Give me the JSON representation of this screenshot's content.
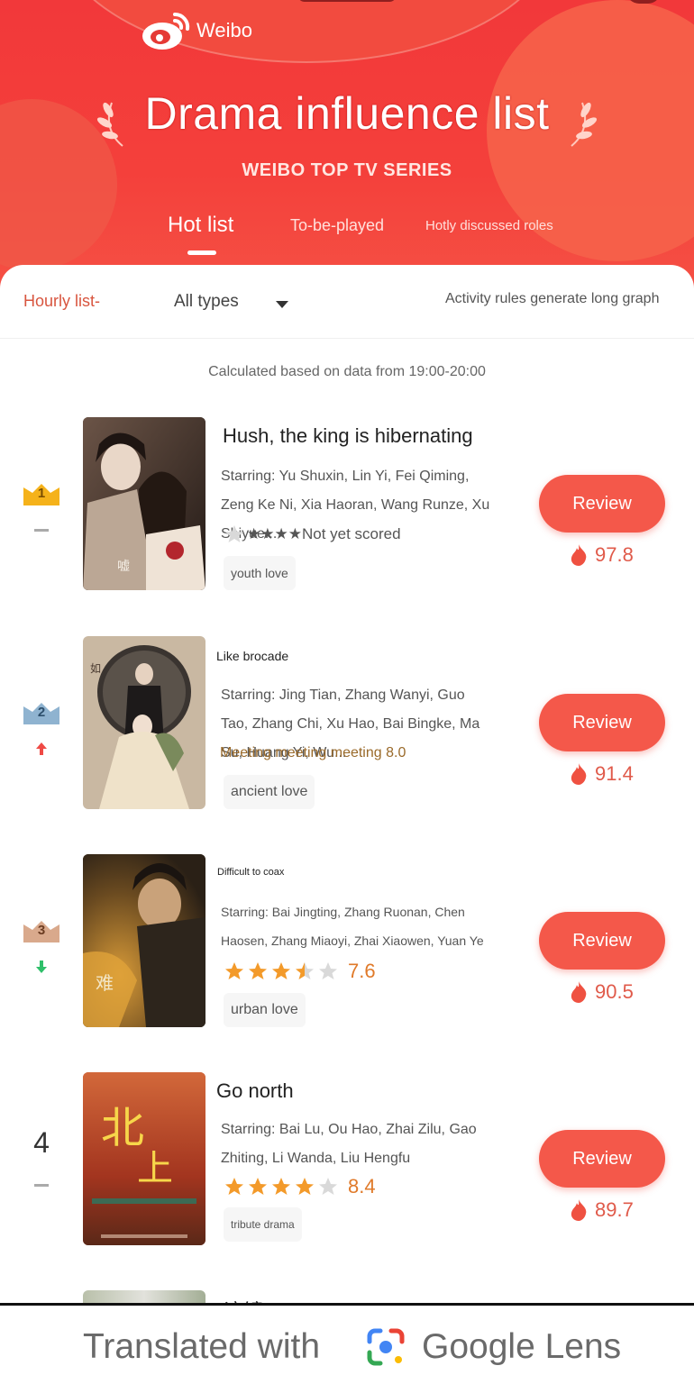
{
  "header": {
    "logo_text": "Weibo",
    "title": "Drama influence list",
    "subtitle": "WEIBO TOP TV SERIES",
    "tabs": [
      {
        "label": "Hot list",
        "active": true
      },
      {
        "label": "To-be-played",
        "active": false
      },
      {
        "label": "Hotly discussed roles",
        "active": false
      }
    ]
  },
  "filters": {
    "period": "Hourly list-",
    "type": "All types",
    "rules": "Activity rules generate long graph"
  },
  "calc_note": "Calculated based on data from 19:00-20:00",
  "items": [
    {
      "rank": "1",
      "trend": "same",
      "name": "Hush, the king is hibernating",
      "starring": "Starring: Yu Shuxin, Lin Yi, Fei Qiming, Zeng Ke Ni, Xia Haoran, Wang Runze, Xu Shiyue...",
      "score": "★★★★Not yet scored",
      "tag": "youth love",
      "review": "Review",
      "heat": "97.8"
    },
    {
      "rank": "2",
      "trend": "up",
      "name": "Like brocade",
      "starring": "Starring: Jing Tian, Zhang Wanyi, Guo Tao, Zhang Chi, Xu Hao, Bai Bingke, Ma Su, Huang Yi, Wu...",
      "score": "Meeting meeting meeting 8.0",
      "tag": "ancient love",
      "review": "Review",
      "heat": "91.4"
    },
    {
      "rank": "3",
      "trend": "down",
      "name": "Difficult to coax",
      "starring": "Starring: Bai Jingting, Zhang Ruonan, Chen Haosen, Zhang Miaoyi, Zhai Xiaowen, Yuan Ye",
      "score": "7.6",
      "stars": 3.5,
      "tag": "urban love",
      "review": "Review",
      "heat": "90.5"
    },
    {
      "rank": "4",
      "trend": "same",
      "name": "Go north",
      "starring": "Starring: Bai Lu, Ou Hao, Zhai Zilu, Gao Zhiting, Li Wanda, Liu Hengfu",
      "score": "8.4",
      "stars": 4,
      "tag": "tribute drama",
      "review": "Review",
      "heat": "89.7"
    }
  ],
  "next_item_peek": "浪镜",
  "footer": {
    "translated": "Translated with",
    "lens": "Google Lens"
  },
  "colors": {
    "brand_red": "#f2383a",
    "review_button": "#f4584a",
    "star": "#f39a2a",
    "accent_text": "#d8553f"
  }
}
